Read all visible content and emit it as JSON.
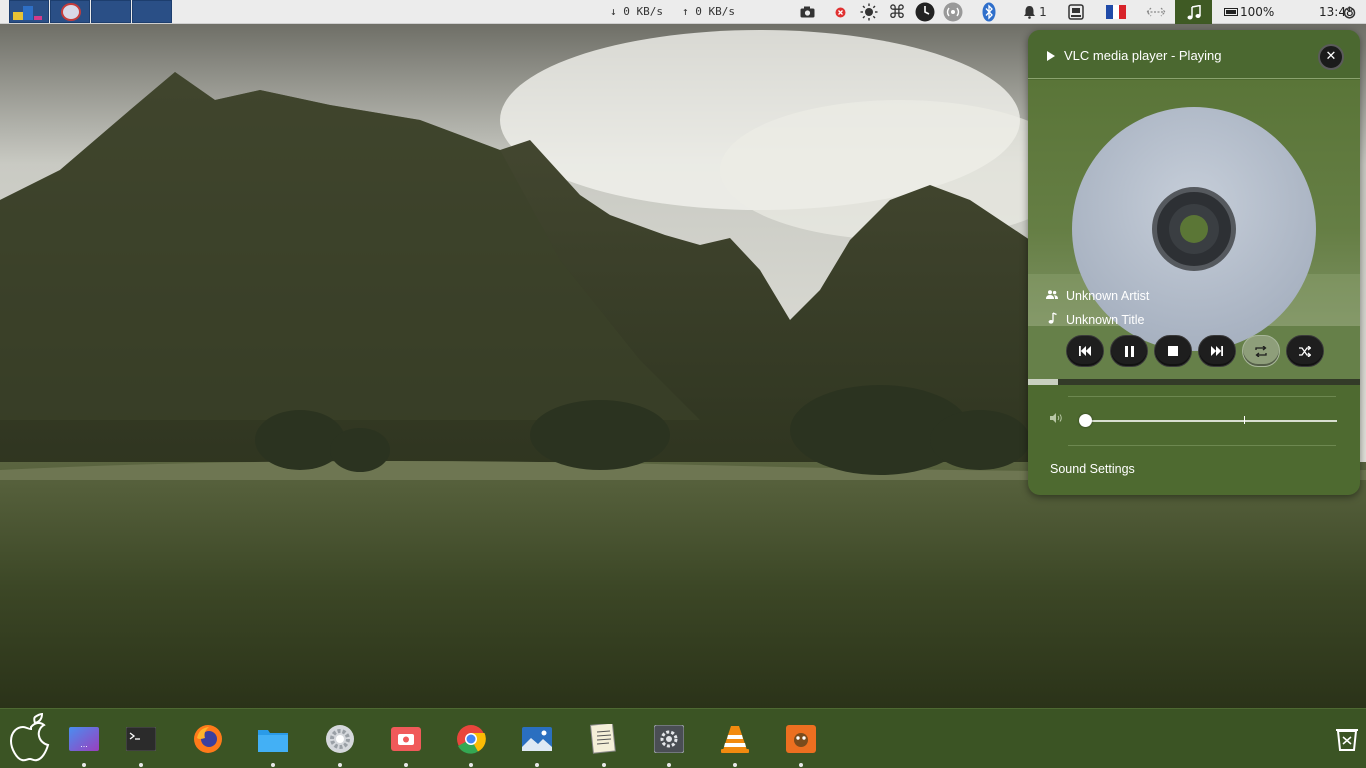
{
  "top_panel": {
    "net_down": "↓ 0 KB/s",
    "net_up": "↑ 0 KB/s",
    "notification_count": "1",
    "battery_percent": "100%",
    "clock": "13:48",
    "tray_icons": [
      "camera-icon",
      "stop-record-icon",
      "brightness-icon",
      "command-icon",
      "clock-icon",
      "wireless-icon",
      "bluetooth-icon",
      "notification-bell-icon",
      "drive-icon",
      "keyboard-layout-flag",
      "network-arrows-icon",
      "music-note-icon",
      "battery-icon",
      "power-icon"
    ],
    "flag_colors": [
      "#1f4aa8",
      "#ffffff",
      "#d8232a"
    ]
  },
  "media_popup": {
    "title": "VLC media player - Playing",
    "close_glyph": "✕",
    "artist": "Unknown Artist",
    "track_title": "Unknown Title",
    "progress_fraction": 0.09,
    "volume_fraction": 0.0,
    "controls": [
      "previous",
      "pause",
      "stop",
      "next",
      "repeat",
      "shuffle"
    ],
    "repeat_active": true,
    "sound_settings_label": "Sound Settings",
    "accent_color": "#4e6a30"
  },
  "dock": {
    "apps": [
      "launcher",
      "terminal",
      "firefox",
      "files",
      "settings",
      "screenshot",
      "chrome",
      "image-viewer",
      "text-editor",
      "system-settings",
      "vlc",
      "gimp"
    ],
    "running": [
      "launcher",
      "terminal",
      "files",
      "settings",
      "screenshot",
      "chrome",
      "image-viewer",
      "text-editor",
      "system-settings",
      "vlc",
      "gimp"
    ]
  }
}
